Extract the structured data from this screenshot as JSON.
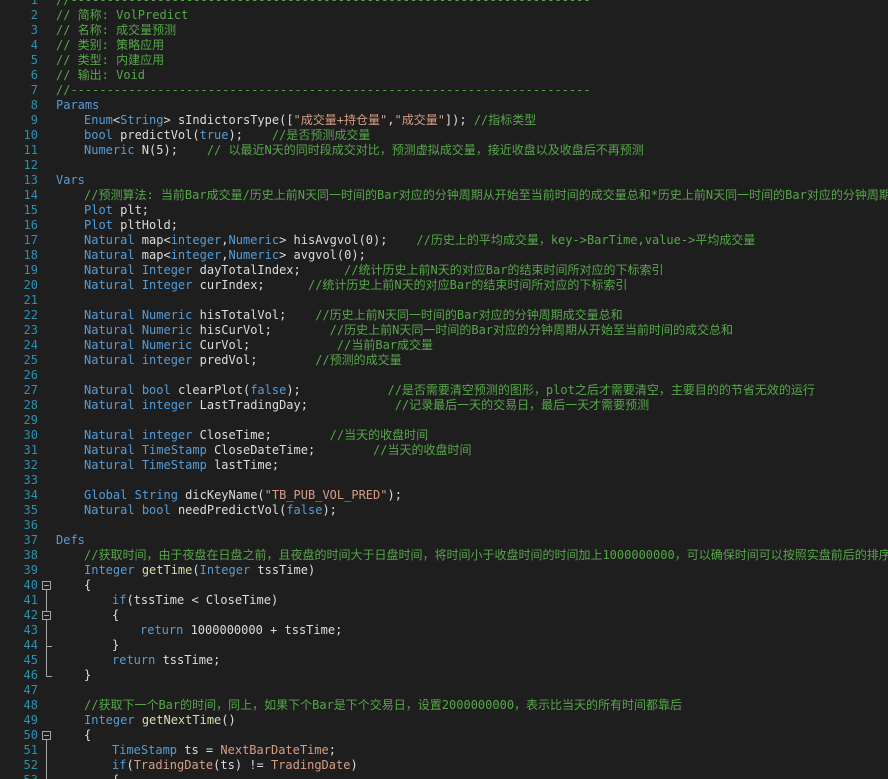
{
  "colors": {
    "background": "#1e1e1e",
    "line_number": "#2b91af",
    "comment": "#57a64a",
    "keyword": "#569cd6",
    "type": "#4ec9b0",
    "identifier": "#dcdcdc",
    "string": "#d69d85",
    "number": "#b5cea8",
    "function": "#dcdcaa",
    "fold_marker": "#a5a5a5"
  },
  "fold_markers": [
    {
      "start": 40,
      "end": 46
    },
    {
      "start": 42,
      "end": 44
    },
    {
      "start": 50,
      "end": 53
    }
  ],
  "lines": [
    {
      "n": "1",
      "indent": 0,
      "tokens": [
        {
          "t": "//------------------------------------------------------------------------",
          "c": "comment"
        }
      ]
    },
    {
      "n": "2",
      "indent": 0,
      "tokens": [
        {
          "t": "// 简称: VolPredict",
          "c": "comment"
        }
      ]
    },
    {
      "n": "3",
      "indent": 0,
      "tokens": [
        {
          "t": "// 名称: 成交量预测",
          "c": "comment"
        }
      ]
    },
    {
      "n": "4",
      "indent": 0,
      "tokens": [
        {
          "t": "// 类别: 策略应用",
          "c": "comment"
        }
      ]
    },
    {
      "n": "5",
      "indent": 0,
      "tokens": [
        {
          "t": "// 类型: 内建应用",
          "c": "comment"
        }
      ]
    },
    {
      "n": "6",
      "indent": 0,
      "tokens": [
        {
          "t": "// 输出: Void",
          "c": "comment"
        }
      ]
    },
    {
      "n": "7",
      "indent": 0,
      "tokens": [
        {
          "t": "//------------------------------------------------------------------------",
          "c": "comment"
        }
      ]
    },
    {
      "n": "8",
      "indent": 0,
      "tokens": [
        {
          "t": "Params",
          "c": "keyword"
        }
      ]
    },
    {
      "n": "9",
      "indent": 1,
      "tokens": [
        {
          "t": "Enum",
          "c": "keyword"
        },
        {
          "t": "<",
          "c": "identifier"
        },
        {
          "t": "String",
          "c": "keyword"
        },
        {
          "t": "> sIndictorsType([",
          "c": "identifier"
        },
        {
          "t": "\"成交量+持仓量\"",
          "c": "string"
        },
        {
          "t": ",",
          "c": "identifier"
        },
        {
          "t": "\"成交量\"",
          "c": "string"
        },
        {
          "t": "]); ",
          "c": "identifier"
        },
        {
          "t": "//指标类型",
          "c": "comment"
        }
      ]
    },
    {
      "n": "10",
      "indent": 1,
      "tokens": [
        {
          "t": "bool",
          "c": "keyword"
        },
        {
          "t": " predictVol(",
          "c": "identifier"
        },
        {
          "t": "true",
          "c": "keyword"
        },
        {
          "t": ");    ",
          "c": "identifier"
        },
        {
          "t": "//是否预测成交量",
          "c": "comment"
        }
      ]
    },
    {
      "n": "11",
      "indent": 1,
      "tokens": [
        {
          "t": "Numeric",
          "c": "keyword"
        },
        {
          "t": " N(5);    ",
          "c": "identifier"
        },
        {
          "t": "// 以最近N天的同时段成交对比，预测虚拟成交量，接近收盘以及收盘后不再预测",
          "c": "comment"
        }
      ]
    },
    {
      "n": "12",
      "indent": 0,
      "tokens": []
    },
    {
      "n": "13",
      "indent": 0,
      "tokens": [
        {
          "t": "Vars",
          "c": "keyword"
        }
      ]
    },
    {
      "n": "14",
      "indent": 1,
      "tokens": [
        {
          "t": "//预测算法: 当前Bar成交量/历史上前N天同一时间的Bar对应的分钟周期从开始至当前时间的成交量总和*历史上前N天同一时间的Bar对应的分钟周期",
          "c": "comment"
        }
      ]
    },
    {
      "n": "15",
      "indent": 1,
      "tokens": [
        {
          "t": "Plot",
          "c": "keyword"
        },
        {
          "t": " plt;",
          "c": "identifier"
        }
      ]
    },
    {
      "n": "16",
      "indent": 1,
      "tokens": [
        {
          "t": "Plot",
          "c": "keyword"
        },
        {
          "t": " pltHold;",
          "c": "identifier"
        }
      ]
    },
    {
      "n": "17",
      "indent": 1,
      "tokens": [
        {
          "t": "Natural",
          "c": "keyword"
        },
        {
          "t": " map<",
          "c": "identifier"
        },
        {
          "t": "integer",
          "c": "keyword"
        },
        {
          "t": ",",
          "c": "identifier"
        },
        {
          "t": "Numeric",
          "c": "keyword"
        },
        {
          "t": "> hisAvgvol(0);    ",
          "c": "identifier"
        },
        {
          "t": "//历史上的平均成交量，key->BarTime,value->平均成交量",
          "c": "comment"
        }
      ]
    },
    {
      "n": "18",
      "indent": 1,
      "tokens": [
        {
          "t": "Natural",
          "c": "keyword"
        },
        {
          "t": " map<",
          "c": "identifier"
        },
        {
          "t": "integer",
          "c": "keyword"
        },
        {
          "t": ",",
          "c": "identifier"
        },
        {
          "t": "Numeric",
          "c": "keyword"
        },
        {
          "t": "> avgvol(0);",
          "c": "identifier"
        }
      ]
    },
    {
      "n": "19",
      "indent": 1,
      "tokens": [
        {
          "t": "Natural",
          "c": "keyword"
        },
        {
          "t": " ",
          "c": "identifier"
        },
        {
          "t": "Integer",
          "c": "keyword"
        },
        {
          "t": " dayTotalIndex;      ",
          "c": "identifier"
        },
        {
          "t": "//统计历史上前N天的对应Bar的结束时间所对应的下标索引",
          "c": "comment"
        }
      ]
    },
    {
      "n": "20",
      "indent": 1,
      "tokens": [
        {
          "t": "Natural",
          "c": "keyword"
        },
        {
          "t": " ",
          "c": "identifier"
        },
        {
          "t": "Integer",
          "c": "keyword"
        },
        {
          "t": " curIndex;      ",
          "c": "identifier"
        },
        {
          "t": "//统计历史上前N天的对应Bar的结束时间所对应的下标索引",
          "c": "comment"
        }
      ]
    },
    {
      "n": "21",
      "indent": 0,
      "tokens": []
    },
    {
      "n": "22",
      "indent": 1,
      "tokens": [
        {
          "t": "Natural",
          "c": "keyword"
        },
        {
          "t": " ",
          "c": "identifier"
        },
        {
          "t": "Numeric",
          "c": "keyword"
        },
        {
          "t": " hisTotalVol;    ",
          "c": "identifier"
        },
        {
          "t": "//历史上前N天同一时间的Bar对应的分钟周期成交量总和",
          "c": "comment"
        }
      ]
    },
    {
      "n": "23",
      "indent": 1,
      "tokens": [
        {
          "t": "Natural",
          "c": "keyword"
        },
        {
          "t": " ",
          "c": "identifier"
        },
        {
          "t": "Numeric",
          "c": "keyword"
        },
        {
          "t": " hisCurVol;        ",
          "c": "identifier"
        },
        {
          "t": "//历史上前N天同一时间的Bar对应的分钟周期从开始至当前时间的成交总和",
          "c": "comment"
        }
      ]
    },
    {
      "n": "24",
      "indent": 1,
      "tokens": [
        {
          "t": "Natural",
          "c": "keyword"
        },
        {
          "t": " ",
          "c": "identifier"
        },
        {
          "t": "Numeric",
          "c": "keyword"
        },
        {
          "t": " CurVol;            ",
          "c": "identifier"
        },
        {
          "t": "//当前Bar成交量",
          "c": "comment"
        }
      ]
    },
    {
      "n": "25",
      "indent": 1,
      "tokens": [
        {
          "t": "Natural",
          "c": "keyword"
        },
        {
          "t": " ",
          "c": "identifier"
        },
        {
          "t": "integer",
          "c": "keyword"
        },
        {
          "t": " predVol;        ",
          "c": "identifier"
        },
        {
          "t": "//预测的成交量",
          "c": "comment"
        }
      ]
    },
    {
      "n": "26",
      "indent": 0,
      "tokens": []
    },
    {
      "n": "27",
      "indent": 1,
      "tokens": [
        {
          "t": "Natural",
          "c": "keyword"
        },
        {
          "t": " ",
          "c": "identifier"
        },
        {
          "t": "bool",
          "c": "keyword"
        },
        {
          "t": " clearPlot(",
          "c": "identifier"
        },
        {
          "t": "false",
          "c": "keyword"
        },
        {
          "t": ");            ",
          "c": "identifier"
        },
        {
          "t": "//是否需要清空预测的图形，plot之后才需要清空，主要目的的节省无效的运行",
          "c": "comment"
        }
      ]
    },
    {
      "n": "28",
      "indent": 1,
      "tokens": [
        {
          "t": "Natural",
          "c": "keyword"
        },
        {
          "t": " ",
          "c": "identifier"
        },
        {
          "t": "integer",
          "c": "keyword"
        },
        {
          "t": " LastTradingDay;            ",
          "c": "identifier"
        },
        {
          "t": "//记录最后一天的交易日，最后一天才需要预测",
          "c": "comment"
        }
      ]
    },
    {
      "n": "29",
      "indent": 0,
      "tokens": []
    },
    {
      "n": "30",
      "indent": 1,
      "tokens": [
        {
          "t": "Natural",
          "c": "keyword"
        },
        {
          "t": " ",
          "c": "identifier"
        },
        {
          "t": "integer",
          "c": "keyword"
        },
        {
          "t": " CloseTime;        ",
          "c": "identifier"
        },
        {
          "t": "//当天的收盘时间",
          "c": "comment"
        }
      ]
    },
    {
      "n": "31",
      "indent": 1,
      "tokens": [
        {
          "t": "Natural",
          "c": "keyword"
        },
        {
          "t": " ",
          "c": "identifier"
        },
        {
          "t": "TimeStamp",
          "c": "keyword"
        },
        {
          "t": " CloseDateTime;        ",
          "c": "identifier"
        },
        {
          "t": "//当天的收盘时间",
          "c": "comment"
        }
      ]
    },
    {
      "n": "32",
      "indent": 1,
      "tokens": [
        {
          "t": "Natural",
          "c": "keyword"
        },
        {
          "t": " ",
          "c": "identifier"
        },
        {
          "t": "TimeStamp",
          "c": "keyword"
        },
        {
          "t": " lastTime;",
          "c": "identifier"
        }
      ]
    },
    {
      "n": "33",
      "indent": 0,
      "tokens": []
    },
    {
      "n": "34",
      "indent": 1,
      "tokens": [
        {
          "t": "Global",
          "c": "keyword"
        },
        {
          "t": " ",
          "c": "identifier"
        },
        {
          "t": "String",
          "c": "keyword"
        },
        {
          "t": " dicKeyName(",
          "c": "identifier"
        },
        {
          "t": "\"TB_PUB_VOL_PRED\"",
          "c": "string"
        },
        {
          "t": ");",
          "c": "identifier"
        }
      ]
    },
    {
      "n": "35",
      "indent": 1,
      "tokens": [
        {
          "t": "Natural",
          "c": "keyword"
        },
        {
          "t": " ",
          "c": "identifier"
        },
        {
          "t": "bool",
          "c": "keyword"
        },
        {
          "t": " needPredictVol(",
          "c": "identifier"
        },
        {
          "t": "false",
          "c": "keyword"
        },
        {
          "t": ");",
          "c": "identifier"
        }
      ]
    },
    {
      "n": "36",
      "indent": 0,
      "tokens": []
    },
    {
      "n": "37",
      "indent": 0,
      "tokens": [
        {
          "t": "Defs",
          "c": "keyword"
        }
      ]
    },
    {
      "n": "38",
      "indent": 1,
      "tokens": [
        {
          "t": "//获取时间，由于夜盘在日盘之前，且夜盘的时间大于日盘时间，将时间小于收盘时间的时间加上1000000000，可以确保时间可以按照实盘前后的排序",
          "c": "comment"
        }
      ]
    },
    {
      "n": "39",
      "indent": 1,
      "tokens": [
        {
          "t": "Integer",
          "c": "keyword"
        },
        {
          "t": " ",
          "c": "identifier"
        },
        {
          "t": "getTime",
          "c": "function"
        },
        {
          "t": "(",
          "c": "identifier"
        },
        {
          "t": "Integer",
          "c": "keyword"
        },
        {
          "t": " tssTime)",
          "c": "identifier"
        }
      ]
    },
    {
      "n": "40",
      "indent": 1,
      "tokens": [
        {
          "t": "{",
          "c": "identifier"
        }
      ]
    },
    {
      "n": "41",
      "indent": 2,
      "tokens": [
        {
          "t": "if",
          "c": "keyword"
        },
        {
          "t": "(tssTime < CloseTime)",
          "c": "identifier"
        }
      ]
    },
    {
      "n": "42",
      "indent": 2,
      "tokens": [
        {
          "t": "{",
          "c": "identifier"
        }
      ]
    },
    {
      "n": "43",
      "indent": 3,
      "tokens": [
        {
          "t": "return",
          "c": "keyword"
        },
        {
          "t": " 1000000000 + tssTime;",
          "c": "identifier"
        }
      ]
    },
    {
      "n": "44",
      "indent": 2,
      "tokens": [
        {
          "t": "}",
          "c": "identifier"
        }
      ]
    },
    {
      "n": "45",
      "indent": 2,
      "tokens": [
        {
          "t": "return",
          "c": "keyword"
        },
        {
          "t": " tssTime;",
          "c": "identifier"
        }
      ]
    },
    {
      "n": "46",
      "indent": 1,
      "tokens": [
        {
          "t": "}",
          "c": "identifier"
        }
      ]
    },
    {
      "n": "47",
      "indent": 0,
      "tokens": []
    },
    {
      "n": "48",
      "indent": 1,
      "tokens": [
        {
          "t": "//获取下一个Bar的时间，同上，如果下个Bar是下个交易日，设置2000000000，表示比当天的所有时间都靠后",
          "c": "comment"
        }
      ]
    },
    {
      "n": "49",
      "indent": 1,
      "tokens": [
        {
          "t": "Integer",
          "c": "keyword"
        },
        {
          "t": " ",
          "c": "identifier"
        },
        {
          "t": "getNextTime",
          "c": "function"
        },
        {
          "t": "()",
          "c": "identifier"
        }
      ]
    },
    {
      "n": "50",
      "indent": 1,
      "tokens": [
        {
          "t": "{",
          "c": "identifier"
        }
      ]
    },
    {
      "n": "51",
      "indent": 2,
      "tokens": [
        {
          "t": "TimeStamp",
          "c": "keyword"
        },
        {
          "t": " ts = ",
          "c": "identifier"
        },
        {
          "t": "NextBarDateTime",
          "c": "string"
        },
        {
          "t": ";",
          "c": "identifier"
        }
      ]
    },
    {
      "n": "52",
      "indent": 2,
      "tokens": [
        {
          "t": "if",
          "c": "keyword"
        },
        {
          "t": "(",
          "c": "identifier"
        },
        {
          "t": "TradingDate",
          "c": "string"
        },
        {
          "t": "(ts) != ",
          "c": "identifier"
        },
        {
          "t": "TradingDate",
          "c": "string"
        },
        {
          "t": ")",
          "c": "identifier"
        }
      ]
    },
    {
      "n": "53",
      "indent": 2,
      "tokens": [
        {
          "t": "{",
          "c": "identifier"
        }
      ]
    }
  ]
}
